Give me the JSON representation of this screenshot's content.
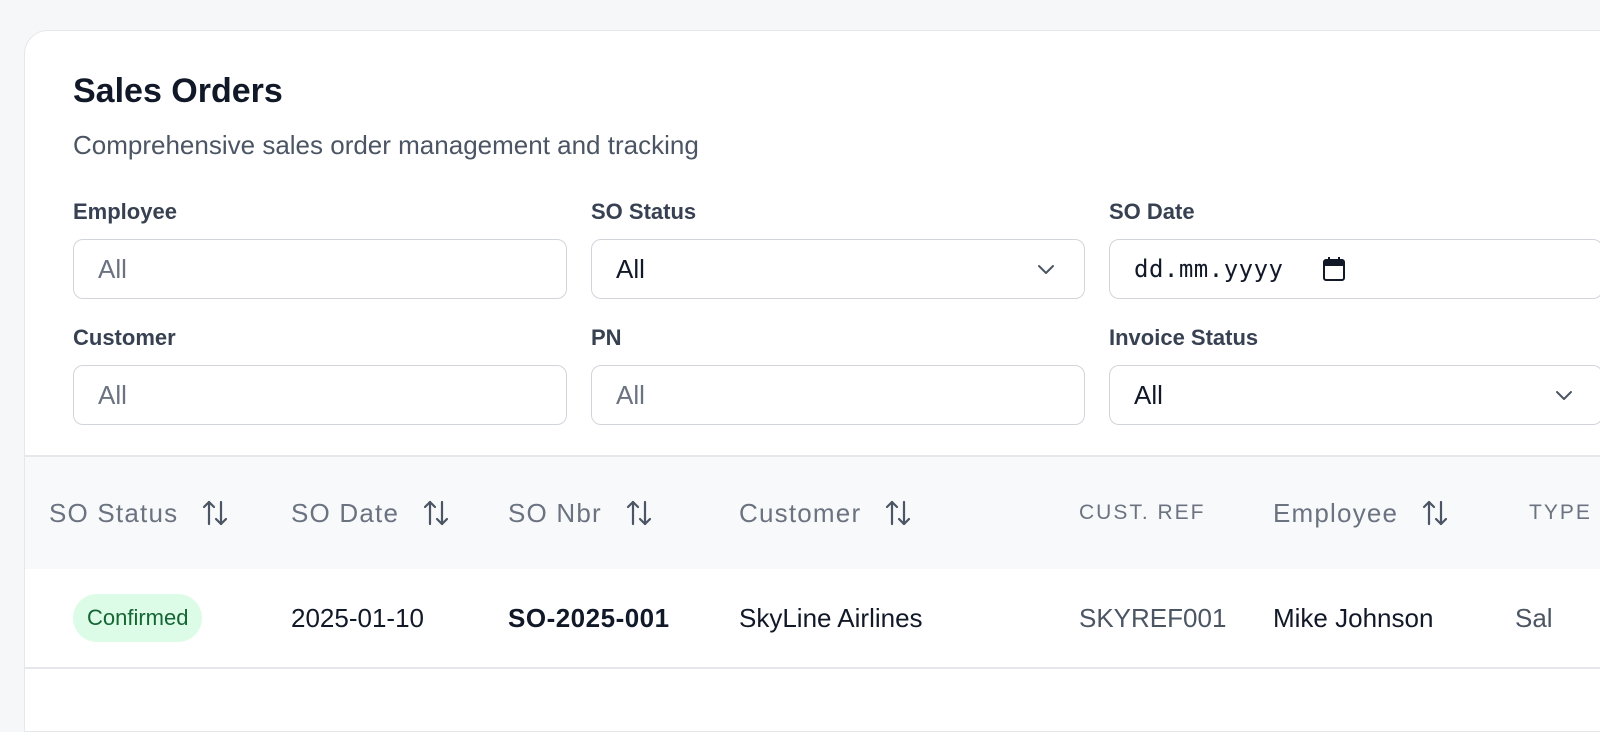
{
  "page": {
    "title": "Sales Orders",
    "subtitle": "Comprehensive sales order management and tracking"
  },
  "filters": {
    "employee": {
      "label": "Employee",
      "placeholder": "All"
    },
    "so_status": {
      "label": "SO Status",
      "value": "All"
    },
    "so_date": {
      "label": "SO Date",
      "placeholder": "dd.mm.yyyy"
    },
    "customer": {
      "label": "Customer",
      "placeholder": "All"
    },
    "pn": {
      "label": "PN",
      "placeholder": "All"
    },
    "invoice_status": {
      "label": "Invoice Status",
      "value": "All"
    }
  },
  "table": {
    "columns": {
      "so_status": "SO Status",
      "so_date": "SO Date",
      "so_nbr": "SO Nbr",
      "customer": "Customer",
      "cust_ref": "CUST. REF",
      "employee": "Employee",
      "type": "TYPE"
    },
    "rows": [
      {
        "status": "Confirmed",
        "date": "2025-01-10",
        "so_nbr": "SO-2025-001",
        "customer": "SkyLine Airlines",
        "cust_ref": "SKYREF001",
        "employee": "Mike Johnson",
        "type": "Sal"
      }
    ]
  },
  "colors": {
    "status_confirmed_bg": "#dcfce7",
    "status_confirmed_text": "#166534"
  }
}
